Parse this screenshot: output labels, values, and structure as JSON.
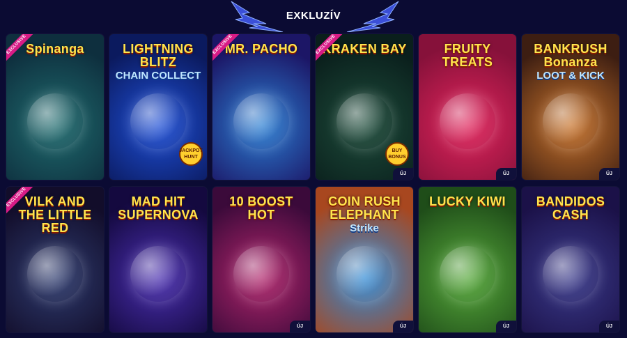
{
  "header": {
    "title": "EXKLUZÍV"
  },
  "labels": {
    "exclusive": "EXCLUSIVE",
    "new": "ÚJ"
  },
  "games": [
    {
      "title": "Spinanga",
      "subtitle": "",
      "exclusive": true,
      "new": false,
      "colors": [
        "#1f6b6e",
        "#0e2f3e"
      ]
    },
    {
      "title": "LIGHTNING BLITZ",
      "subtitle": "CHAIN COLLECT",
      "exclusive": false,
      "new": false,
      "sticker": "JACKPOT HUNT",
      "colors": [
        "#1e4fd6",
        "#0b1a5e"
      ]
    },
    {
      "title": "MR. PACHO",
      "subtitle": "",
      "exclusive": true,
      "new": false,
      "colors": [
        "#2b7fd3",
        "#1c1666"
      ]
    },
    {
      "title": "KRAKEN BAY",
      "subtitle": "",
      "exclusive": true,
      "new": true,
      "sticker": "BUY BONUS",
      "colors": [
        "#1d4b3a",
        "#0a1f1c"
      ]
    },
    {
      "title": "FRUITY TREATS",
      "subtitle": "",
      "exclusive": false,
      "new": true,
      "colors": [
        "#e0245b",
        "#86113a"
      ]
    },
    {
      "title": "BANKRUSH Bonanza",
      "subtitle": "LOOT & KICK",
      "exclusive": false,
      "new": true,
      "colors": [
        "#c8732b",
        "#3d1e12"
      ]
    },
    {
      "title": "VILK AND THE LITTLE RED",
      "subtitle": "",
      "exclusive": true,
      "new": false,
      "colors": [
        "#2e3b6e",
        "#120d2a"
      ]
    },
    {
      "title": "MAD HIT SUPERNOVA",
      "subtitle": "",
      "exclusive": false,
      "new": false,
      "colors": [
        "#4a2fb0",
        "#14093f"
      ]
    },
    {
      "title": "10 BOOST HOT",
      "subtitle": "",
      "exclusive": false,
      "new": true,
      "colors": [
        "#b0256b",
        "#3b0a3a"
      ]
    },
    {
      "title": "COIN RUSH ELEPHANT",
      "subtitle": "Strike",
      "exclusive": false,
      "new": true,
      "colors": [
        "#2e8ad6",
        "#a8471f"
      ]
    },
    {
      "title": "LUCKY KIWI",
      "subtitle": "",
      "exclusive": false,
      "new": true,
      "colors": [
        "#56a83a",
        "#1f4d19"
      ]
    },
    {
      "title": "BANDIDOS CASH",
      "subtitle": "",
      "exclusive": false,
      "new": true,
      "colors": [
        "#3a3a8a",
        "#1b1148"
      ]
    }
  ],
  "colors": {
    "background": "#0b0b33",
    "accent_bolt": "#3b4fd8",
    "exclusive_ribbon": "#d81b86"
  }
}
